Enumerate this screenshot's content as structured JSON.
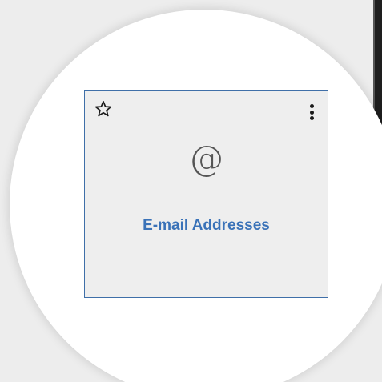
{
  "tile": {
    "label": "E-mail Addresses",
    "icon": "at-sign-icon",
    "icon_glyph": "@",
    "favorite_icon": "star-outline-icon",
    "menu_icon": "kebab-menu-icon",
    "colors": {
      "label": "#3a72b8",
      "border": "#3f6fa8",
      "background": "#eeeeee"
    }
  }
}
